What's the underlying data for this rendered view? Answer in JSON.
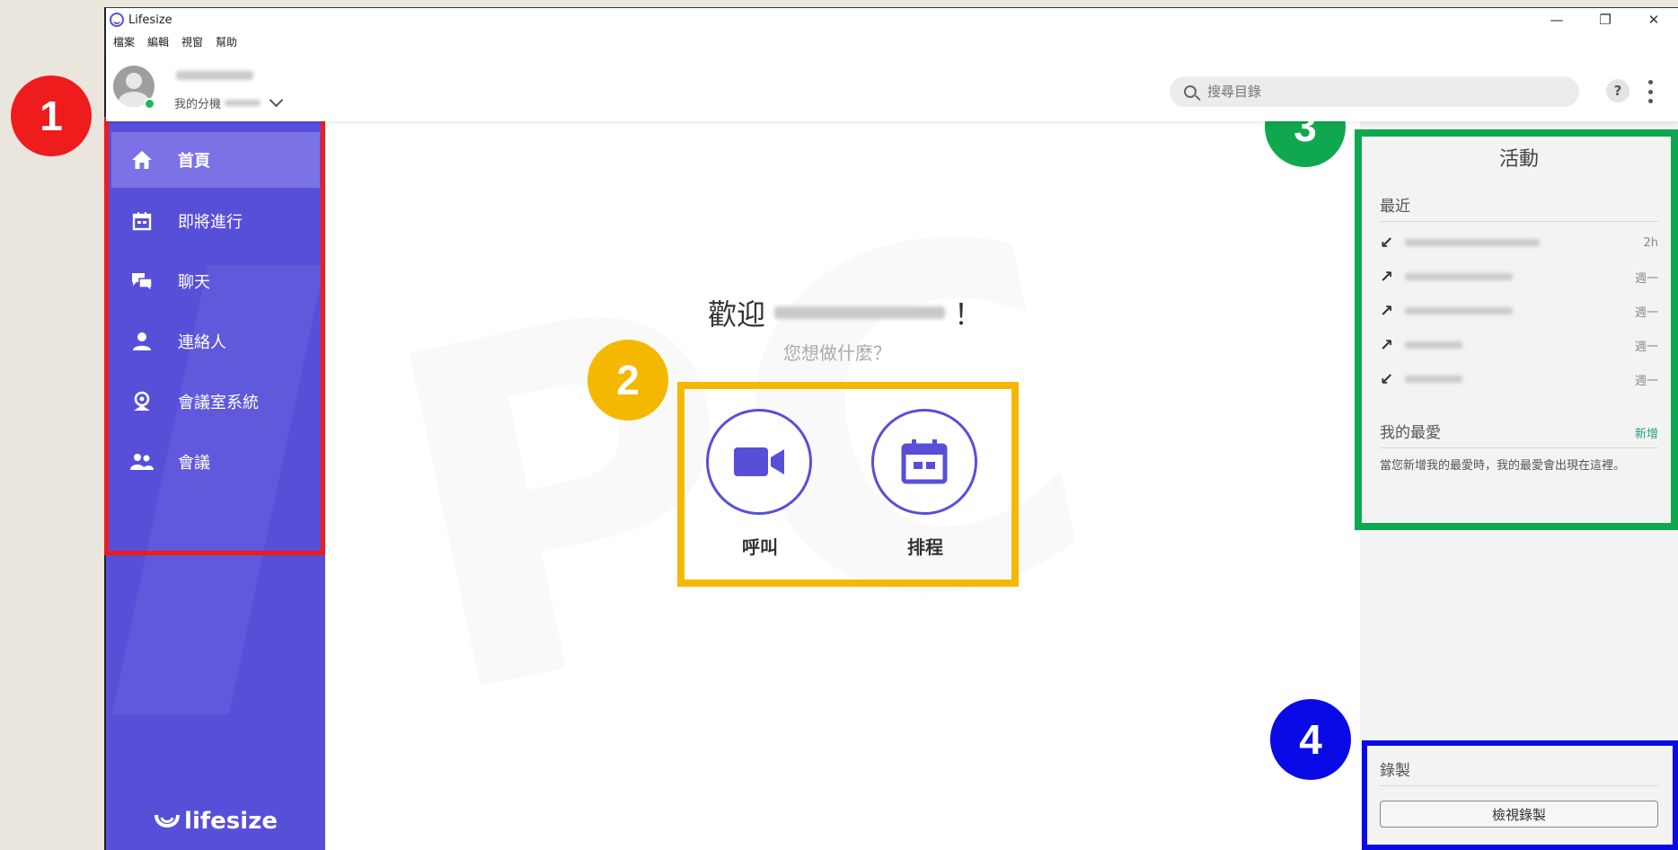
{
  "window": {
    "title": "Lifesize",
    "controls": [
      "—",
      "❐",
      "✕"
    ]
  },
  "menu": [
    "檔案",
    "編輯",
    "視窗",
    "幫助"
  ],
  "header": {
    "extension_label": "我的分機",
    "search_placeholder": "搜尋目錄",
    "help_label": "?"
  },
  "sidebar": {
    "items": [
      {
        "label": "首頁",
        "icon": "home-icon",
        "active": true
      },
      {
        "label": "即將進行",
        "icon": "calendar-icon",
        "active": false
      },
      {
        "label": "聊天",
        "icon": "chat-icon",
        "active": false
      },
      {
        "label": "連絡人",
        "icon": "person-icon",
        "active": false
      },
      {
        "label": "會議室系統",
        "icon": "room-system-icon",
        "active": false
      },
      {
        "label": "會議",
        "icon": "group-icon",
        "active": false
      }
    ],
    "brand": "lifesize"
  },
  "main": {
    "welcome_prefix": "歡迎",
    "welcome_suffix": "！",
    "subtitle": "您想做什麼？",
    "actions": [
      {
        "label": "呼叫",
        "icon": "video-camera-icon"
      },
      {
        "label": "排程",
        "icon": "calendar-icon"
      }
    ]
  },
  "activity": {
    "title": "活動",
    "recent_label": "最近",
    "recent": [
      {
        "direction": "↙",
        "when": "2h"
      },
      {
        "direction": "↗",
        "when": "週一"
      },
      {
        "direction": "↗",
        "when": "週一"
      },
      {
        "direction": "↗",
        "when": "週一"
      },
      {
        "direction": "↙",
        "when": "週一"
      }
    ],
    "favorites_label": "我的最愛",
    "favorites_add": "新增",
    "favorites_note": "當您新增我的最愛時，我的最愛會出現在這裡。"
  },
  "recording": {
    "label": "錄製",
    "button": "檢視錄製"
  },
  "annotations": {
    "badges": [
      "1",
      "2",
      "3",
      "4"
    ],
    "colors": {
      "1": "#ee1c1c",
      "2": "#f5b800",
      "3": "#10a84f",
      "4": "#0a0ae6"
    }
  },
  "colors": {
    "sidebar": "#584fd9",
    "sidebar_active": "#7a72e5",
    "accent": "#584fd9",
    "presence": "#1db954"
  }
}
